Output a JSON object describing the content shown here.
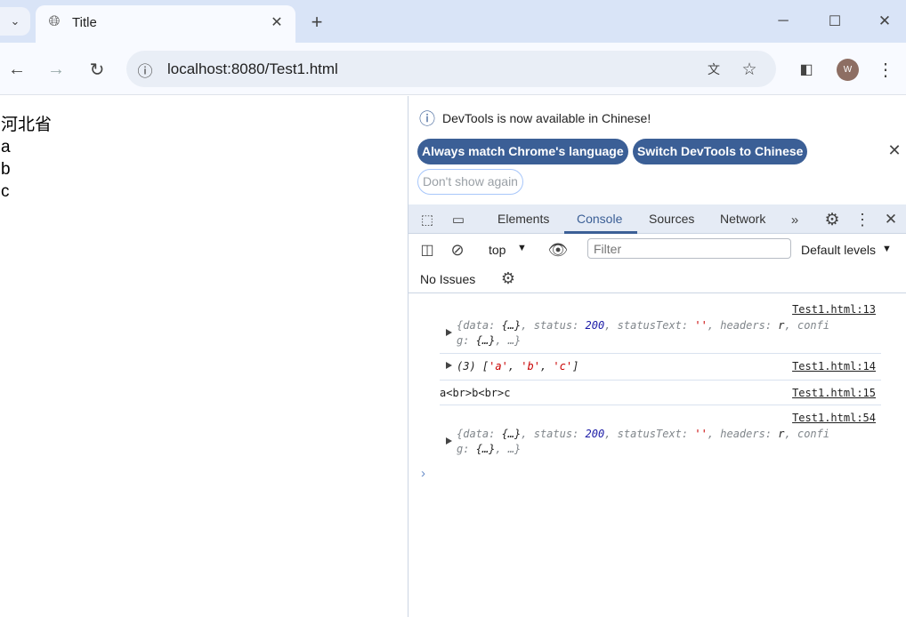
{
  "browser": {
    "tab_title": "Title",
    "url": "localhost:8080/Test1.html",
    "avatar_letter": "W"
  },
  "page": {
    "lines": [
      "河北省",
      "a",
      "b",
      "c"
    ]
  },
  "devtools": {
    "infobar": {
      "message": "DevTools is now available in Chinese!",
      "btn_match": "Always match Chrome's language",
      "btn_switch": "Switch DevTools to Chinese",
      "btn_dismiss": "Don't show again"
    },
    "tabs": [
      "Elements",
      "Console",
      "Sources",
      "Network"
    ],
    "active_tab": "Console",
    "console_toolbar": {
      "context": "top",
      "filter_placeholder": "Filter",
      "levels": "Default levels",
      "issues": "No Issues"
    },
    "messages": [
      {
        "source": "Test1.html:13"
      },
      {
        "source": "Test1.html:14",
        "text": "(3) ['a', 'b', 'c']"
      },
      {
        "source": "Test1.html:15",
        "text": "a<br>b<br>c"
      },
      {
        "source": "Test1.html:54"
      }
    ],
    "accent": "#3b5f96"
  }
}
